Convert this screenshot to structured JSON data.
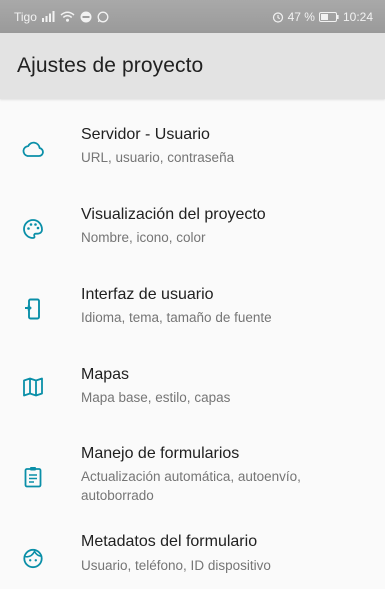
{
  "status_bar": {
    "carrier": "Tigo",
    "battery": "47 %",
    "time": "10:24",
    "icons": [
      "signal-icon",
      "wifi-icon",
      "data-saver-icon",
      "whatsapp-icon",
      "alarm-icon",
      "battery-icon"
    ]
  },
  "app_bar": {
    "title": "Ajustes de proyecto"
  },
  "accent_color": "#0a8fa8",
  "items": [
    {
      "title": "Servidor - Usuario",
      "subtitle": "URL, usuario, contraseña",
      "icon": "cloud-icon"
    },
    {
      "title": "Visualización del proyecto",
      "subtitle": "Nombre, icono, color",
      "icon": "palette-icon"
    },
    {
      "title": "Interfaz de usuario",
      "subtitle": "Idioma, tema, tamaño de fuente",
      "icon": "phone-settings-icon"
    },
    {
      "title": "Mapas",
      "subtitle": "Mapa base, estilo, capas",
      "icon": "map-icon"
    },
    {
      "title": "Manejo de formularios",
      "subtitle": "Actualización automática, autoenvío, autoborrado",
      "icon": "clipboard-icon"
    },
    {
      "title": "Metadatos del formulario",
      "subtitle": "Usuario, teléfono, ID dispositivo",
      "icon": "face-icon"
    }
  ]
}
